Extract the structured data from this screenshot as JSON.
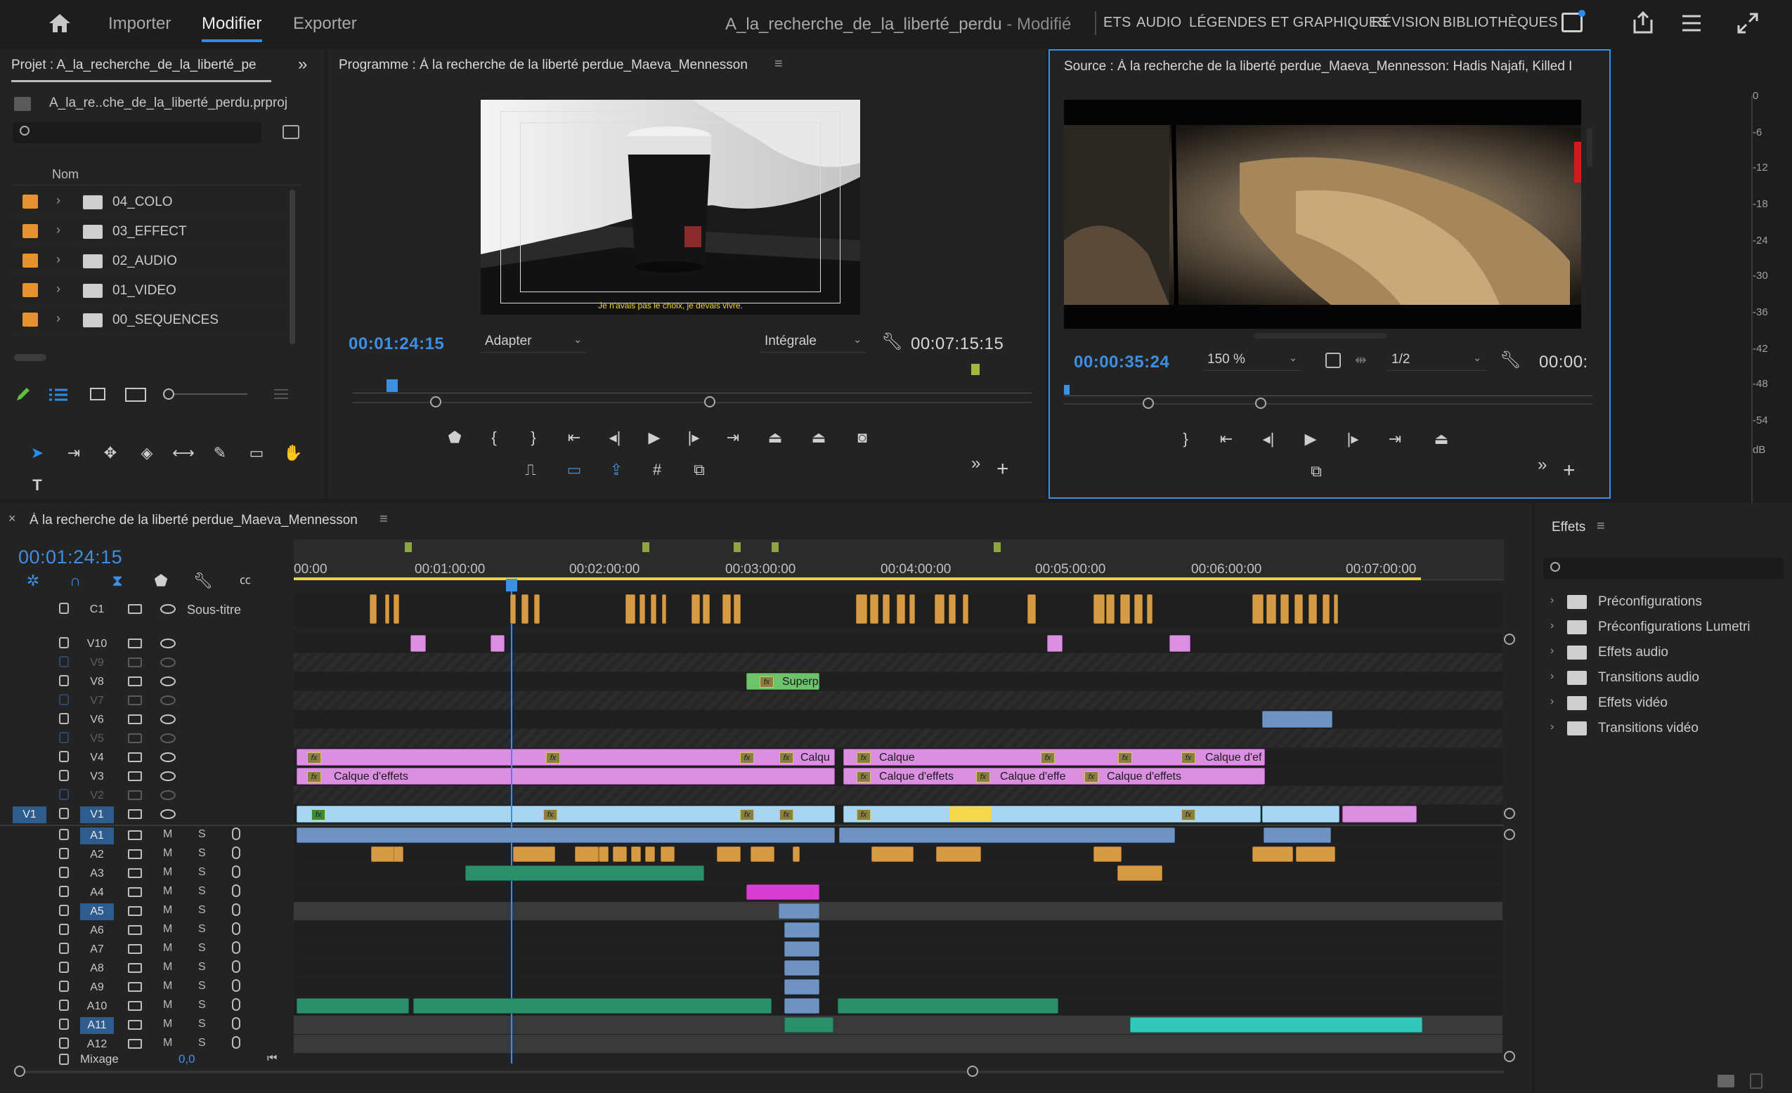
{
  "topbar": {
    "tabs": [
      "Importer",
      "Modifier",
      "Exporter"
    ],
    "active_tab": "Modifier",
    "doc_title": "A_la_recherche_de_la_liberté_perdu",
    "doc_status": "- Modifié",
    "workspaces": [
      "ETS",
      "AUDIO",
      "LÉGENDES ET GRAPHIQUES",
      "RÉVISION",
      "BIBLIOTHÈQUES"
    ]
  },
  "project": {
    "title": "Projet : A_la_recherche_de_la_liberté_pe",
    "file": "A_la_re..che_de_la_liberté_perdu.prproj",
    "column": "Nom",
    "items": [
      "04_COLO",
      "03_EFFECT",
      "02_AUDIO",
      "01_VIDEO",
      "00_SEQUENCES"
    ]
  },
  "program": {
    "title": "Programme : À la recherche de la liberté perdue_Maeva_Mennesson",
    "timecode": "00:01:24:15",
    "fit": "Adapter",
    "quality": "Intégrale",
    "duration": "00:07:15:15",
    "subtitle": "Je n'avais pas le choix, je devais vivre."
  },
  "source": {
    "title": "Source : À la recherche de la liberté perdue_Maeva_Mennesson: Hadis Najafi, Killed I",
    "timecode": "00:00:35:24",
    "zoom": "150 %",
    "resolution": "1/2",
    "duration": "00:00:"
  },
  "meter": {
    "labels": [
      "0",
      "-6",
      "-12",
      "-18",
      "-24",
      "-30",
      "-36",
      "-42",
      "-48",
      "-54",
      "dB"
    ]
  },
  "timeline": {
    "title": "À la recherche de la liberté perdue_Maeva_Mennesson",
    "timecode": "00:01:24:15",
    "ruler": [
      "00:00",
      "00:01:00:00",
      "00:02:00:00",
      "00:03:00:00",
      "00:04:00:00",
      "00:05:00:00",
      "00:06:00:00",
      "00:07:00:00"
    ],
    "caption_track": {
      "name": "C1",
      "label": "Sous-titre"
    },
    "video_tracks": [
      "V10",
      "V9",
      "V8",
      "V7",
      "V6",
      "V5",
      "V4",
      "V3",
      "V2",
      "V1"
    ],
    "audio_tracks": [
      "A1",
      "A2",
      "A3",
      "A4",
      "A5",
      "A6",
      "A7",
      "A8",
      "A9",
      "A10",
      "A11",
      "A12"
    ],
    "source_patch": "V1",
    "mix_label": "Mixage",
    "mix_value": "0,0",
    "clip_labels": {
      "superp": "Superp",
      "calque_short": "Calqu",
      "calque": "Calque",
      "calque_def": "Calque d'ef",
      "calque_effets": "Calque d'effets",
      "calque_effe": "Calque d'effe",
      "m": "M",
      "s": "S"
    }
  },
  "effects": {
    "title": "Effets",
    "items": [
      "Préconfigurations",
      "Préconfigurations Lumetri",
      "Effets audio",
      "Transitions audio",
      "Effets vidéo",
      "Transitions vidéo"
    ]
  },
  "colors": {
    "accent_blue": "#3d8fe4",
    "label_orange": "#e6922e",
    "clip_pink": "#db8fe0",
    "clip_lightblue": "#a8d6f0",
    "clip_green": "#2c8f6b"
  }
}
